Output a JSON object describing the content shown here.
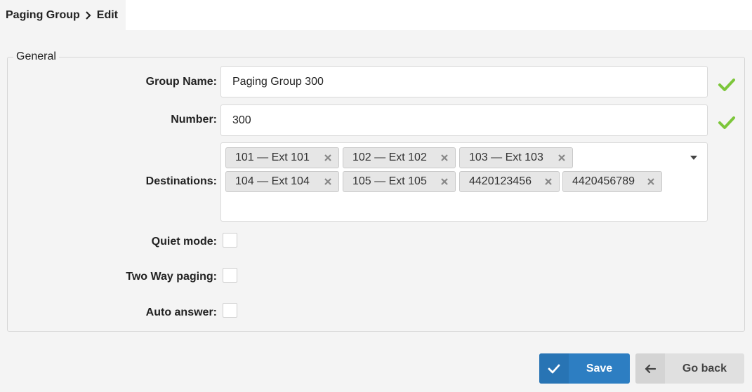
{
  "breadcrumb": {
    "parent": "Paging Group",
    "current": "Edit"
  },
  "section": {
    "legend": "General"
  },
  "form": {
    "group_name": {
      "label": "Group Name:",
      "value": "Paging Group 300",
      "valid": true
    },
    "number": {
      "label": "Number:",
      "value": "300",
      "valid": true
    },
    "destinations": {
      "label": "Destinations:",
      "tags": [
        "101 — Ext 101",
        "102 — Ext 102",
        "103 — Ext 103",
        "104 — Ext 104",
        "105 — Ext 105",
        "4420123456",
        "4420456789"
      ]
    },
    "quiet_mode": {
      "label": "Quiet mode:",
      "checked": false
    },
    "two_way_paging": {
      "label": "Two Way paging:",
      "checked": false
    },
    "auto_answer": {
      "label": "Auto answer:",
      "checked": false
    }
  },
  "actions": {
    "save_label": "Save",
    "back_label": "Go back"
  },
  "colors": {
    "primary": "#2d7ec2",
    "valid": "#7cc63a",
    "background": "#f4f4f4"
  },
  "icons": {
    "breadcrumb_separator": "chevron-right-icon",
    "valid": "checkmark-icon",
    "tag_remove": "close-icon",
    "dropdown": "caret-down-icon",
    "save": "checkmark-icon",
    "back": "arrow-left-icon"
  }
}
